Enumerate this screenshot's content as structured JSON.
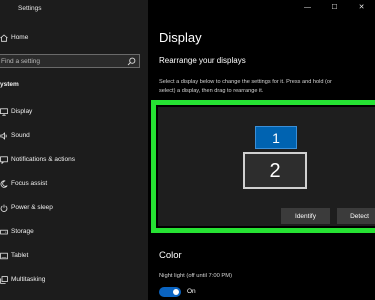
{
  "window": {
    "title": "Settings",
    "controls": {
      "minimize": "—",
      "maximize": "☐",
      "close": "✕"
    }
  },
  "sidebar": {
    "home": "Home",
    "search_placeholder": "Find a setting",
    "section": "ystem",
    "items": [
      {
        "label": "Display",
        "icon": "monitor-icon"
      },
      {
        "label": "Sound",
        "icon": "speaker-icon"
      },
      {
        "label": "Notifications & actions",
        "icon": "notification-icon"
      },
      {
        "label": "Focus assist",
        "icon": "moon-icon"
      },
      {
        "label": "Power & sleep",
        "icon": "power-icon"
      },
      {
        "label": "Storage",
        "icon": "storage-icon"
      },
      {
        "label": "Tablet",
        "icon": "tablet-icon"
      },
      {
        "label": "Multitasking",
        "icon": "multitasking-icon"
      }
    ]
  },
  "main": {
    "title": "Display",
    "rearrange": {
      "heading": "Rearrange your displays",
      "description_line1": "Select a display below to change the settings for it. Press and hold (or",
      "description_line2": "select) a display, then drag to rearrange it.",
      "monitor1": "1",
      "monitor2": "2",
      "identify_label": "Identify",
      "detect_label": "Detect",
      "highlight_color": "#26e233",
      "selected_color": "#0063b1"
    },
    "color": {
      "heading": "Color",
      "night_light_label": "Night light (off until 7:00 PM)",
      "toggle_state": "On",
      "toggle_on": true
    }
  }
}
